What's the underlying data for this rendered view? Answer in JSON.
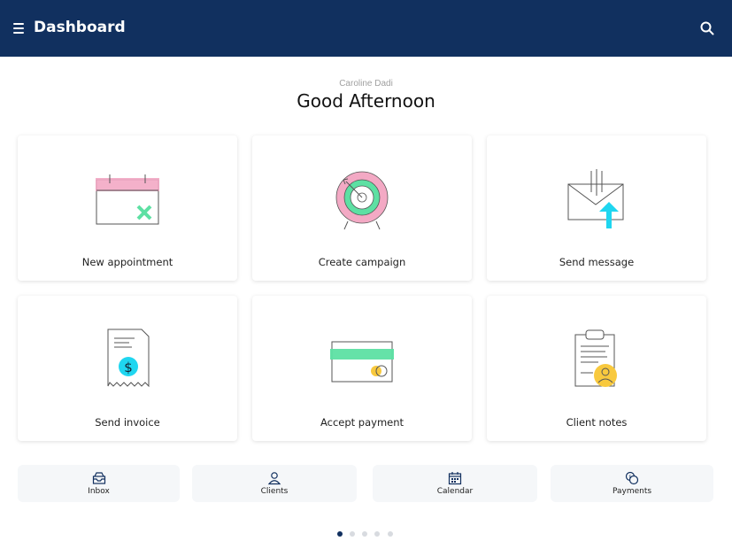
{
  "header": {
    "title": "Dashboard",
    "menu_icon": "hamburger-menu-icon",
    "search_icon": "search-icon"
  },
  "greeting": {
    "user_name": "Caroline Dadi",
    "message": "Good Afternoon"
  },
  "actions": [
    {
      "label": "New appointment",
      "icon": "calendar-icon"
    },
    {
      "label": "Create campaign",
      "icon": "target-icon"
    },
    {
      "label": "Send message",
      "icon": "envelope-icon"
    },
    {
      "label": "Send invoice",
      "icon": "receipt-icon"
    },
    {
      "label": "Accept payment",
      "icon": "credit-card-icon"
    },
    {
      "label": "Client notes",
      "icon": "clipboard-icon"
    }
  ],
  "bottom_nav": [
    {
      "label": "Inbox",
      "icon": "inbox-icon"
    },
    {
      "label": "Clients",
      "icon": "clients-icon"
    },
    {
      "label": "Calendar",
      "icon": "calendar-icon"
    },
    {
      "label": "Payments",
      "icon": "payments-icon"
    }
  ],
  "pagination": {
    "pages": 5,
    "current": 1
  },
  "colors": {
    "header": "#11305f",
    "accent_pink": "#f3a9c4",
    "accent_green": "#5de0a3",
    "accent_cyan": "#1fd6f0",
    "accent_yellow": "#f8c93e"
  }
}
